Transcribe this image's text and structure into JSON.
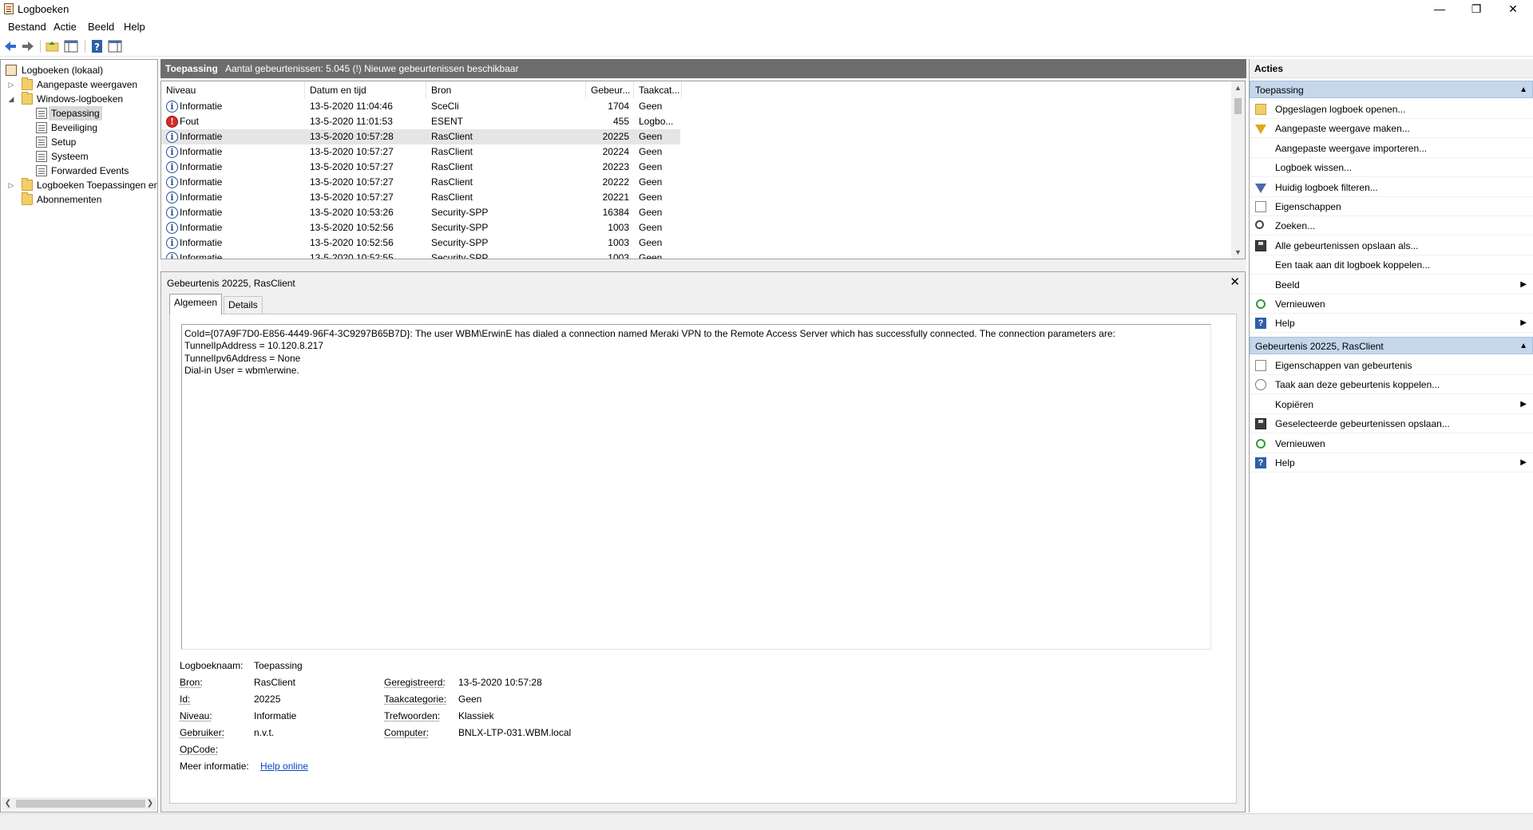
{
  "window": {
    "title": "Logboeken",
    "minimize": "—",
    "restore": "❐",
    "close": "✕"
  },
  "menu": [
    "Bestand",
    "Actie",
    "Beeld",
    "Help"
  ],
  "tree": {
    "root": "Logboeken (lokaal)",
    "custom_views": "Aangepaste weergaven",
    "windows_logs": "Windows-logboeken",
    "children": [
      "Toepassing",
      "Beveiliging",
      "Setup",
      "Systeem",
      "Forwarded Events"
    ],
    "app_logs": "Logboeken Toepassingen en",
    "subscriptions": "Abonnementen"
  },
  "log": {
    "name": "Toepassing",
    "count_text": "Aantal gebeurtenissen: 5.045 (!) Nieuwe gebeurtenissen beschikbaar"
  },
  "columns": [
    "Niveau",
    "Datum en tijd",
    "Bron",
    "Gebeur...",
    "Taakcat..."
  ],
  "events": [
    {
      "level": "Informatie",
      "type": "info",
      "date": "13-5-2020 11:04:46",
      "source": "SceCli",
      "id": "1704",
      "task": "Geen"
    },
    {
      "level": "Fout",
      "type": "error",
      "date": "13-5-2020 11:01:53",
      "source": "ESENT",
      "id": "455",
      "task": "Logbo..."
    },
    {
      "level": "Informatie",
      "type": "info",
      "date": "13-5-2020 10:57:28",
      "source": "RasClient",
      "id": "20225",
      "task": "Geen"
    },
    {
      "level": "Informatie",
      "type": "info",
      "date": "13-5-2020 10:57:27",
      "source": "RasClient",
      "id": "20224",
      "task": "Geen"
    },
    {
      "level": "Informatie",
      "type": "info",
      "date": "13-5-2020 10:57:27",
      "source": "RasClient",
      "id": "20223",
      "task": "Geen"
    },
    {
      "level": "Informatie",
      "type": "info",
      "date": "13-5-2020 10:57:27",
      "source": "RasClient",
      "id": "20222",
      "task": "Geen"
    },
    {
      "level": "Informatie",
      "type": "info",
      "date": "13-5-2020 10:57:27",
      "source": "RasClient",
      "id": "20221",
      "task": "Geen"
    },
    {
      "level": "Informatie",
      "type": "info",
      "date": "13-5-2020 10:53:26",
      "source": "Security-SPP",
      "id": "16384",
      "task": "Geen"
    },
    {
      "level": "Informatie",
      "type": "info",
      "date": "13-5-2020 10:52:56",
      "source": "Security-SPP",
      "id": "1003",
      "task": "Geen"
    },
    {
      "level": "Informatie",
      "type": "info",
      "date": "13-5-2020 10:52:56",
      "source": "Security-SPP",
      "id": "1003",
      "task": "Geen"
    },
    {
      "level": "Informatie",
      "type": "info",
      "date": "13-5-2020 10:52:55",
      "source": "Security-SPP",
      "id": "1003",
      "task": "Geen"
    }
  ],
  "detail": {
    "title": "Gebeurtenis 20225, RasClient",
    "close": "✕",
    "tabs": [
      "Algemeen",
      "Details"
    ],
    "message": [
      "CoId={07A9F7D0-E856-4449-96F4-3C9297B65B7D}: The user WBM\\ErwinE has dialed a connection named Meraki VPN to the Remote Access Server which has successfully connected. The connection parameters are:",
      "TunnelIpAddress = 10.120.8.217",
      "TunnelIpv6Address = None",
      "Dial-in User = wbm\\erwine."
    ],
    "props": {
      "logname_label": "Logboeknaam:",
      "logname": "Toepassing",
      "source_label": "Bron:",
      "source": "RasClient",
      "id_label": "Id:",
      "id": "20225",
      "level_label": "Niveau:",
      "level": "Informatie",
      "user_label": "Gebruiker:",
      "user": "n.v.t.",
      "opcode_label": "OpCode:",
      "more_label": "Meer informatie:",
      "more_link": "Help online",
      "logged_label": "Geregistreerd:",
      "logged": "13-5-2020 10:57:28",
      "task_label": "Taakcategorie:",
      "task": "Geen",
      "keywords_label": "Trefwoorden:",
      "keywords": "Klassiek",
      "computer_label": "Computer:",
      "computer": "BNLX-LTP-031.WBM.local"
    }
  },
  "actions": {
    "title": "Acties",
    "section1": "Toepassing",
    "items1": [
      "Opgeslagen logboek openen...",
      "Aangepaste weergave maken...",
      "Aangepaste weergave importeren...",
      "Logboek wissen...",
      "Huidig logboek filteren...",
      "Eigenschappen",
      "Zoeken...",
      "Alle gebeurtenissen opslaan als...",
      "Een taak aan dit logboek koppelen...",
      "Beeld",
      "Vernieuwen",
      "Help"
    ],
    "section2": "Gebeurtenis 20225, RasClient",
    "items2": [
      "Eigenschappen van gebeurtenis",
      "Taak aan deze gebeurtenis koppelen...",
      "Kopiëren",
      "Geselecteerde gebeurtenissen opslaan...",
      "Vernieuwen",
      "Help"
    ]
  }
}
